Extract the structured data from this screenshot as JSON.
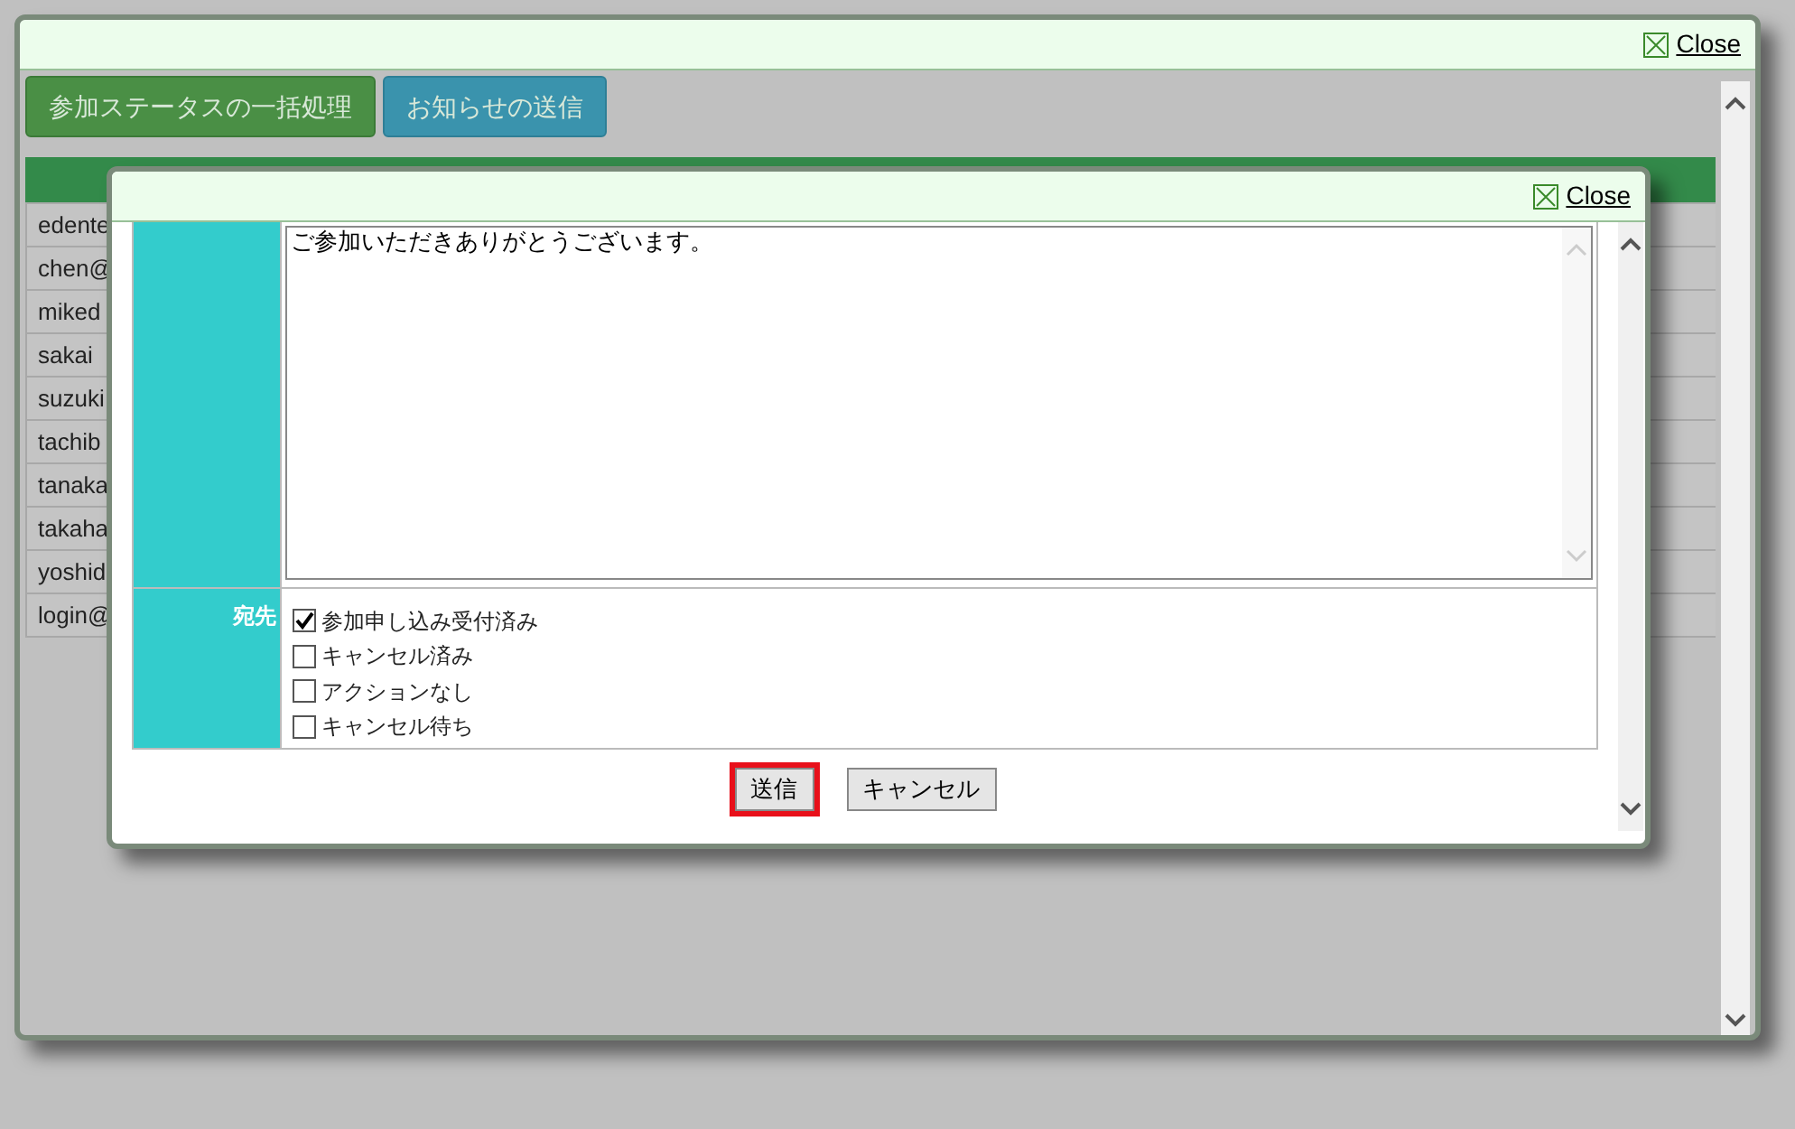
{
  "outer_dialog": {
    "close_label": "Close",
    "actions": [
      {
        "label": "参加ステータスの一括処理",
        "kind": "primary"
      },
      {
        "label": "お知らせの送信",
        "kind": "info"
      }
    ],
    "table": {
      "rows": [
        {
          "column_1": "edente"
        },
        {
          "column_1": "chen@"
        },
        {
          "column_1": "miked"
        },
        {
          "column_1": "sakai"
        },
        {
          "column_1": "suzuki"
        },
        {
          "column_1": "tachib"
        },
        {
          "column_1": "tanaka"
        },
        {
          "column_1": "takaha"
        },
        {
          "column_1": "yoshid"
        },
        {
          "column_1": "login@"
        }
      ]
    }
  },
  "inner_dialog": {
    "close_label": "Close",
    "message": {
      "value": "ご参加いただきありがとうございます。"
    },
    "recipients": {
      "label": "宛先",
      "options": [
        {
          "label": "参加申し込み受付済み",
          "checked": true
        },
        {
          "label": "キャンセル済み",
          "checked": false
        },
        {
          "label": "アクションなし",
          "checked": false
        },
        {
          "label": "キャンセル待ち",
          "checked": false
        }
      ]
    },
    "buttons": [
      {
        "label": "送信",
        "focused": true
      },
      {
        "label": "キャンセル",
        "focused": false
      }
    ]
  }
}
